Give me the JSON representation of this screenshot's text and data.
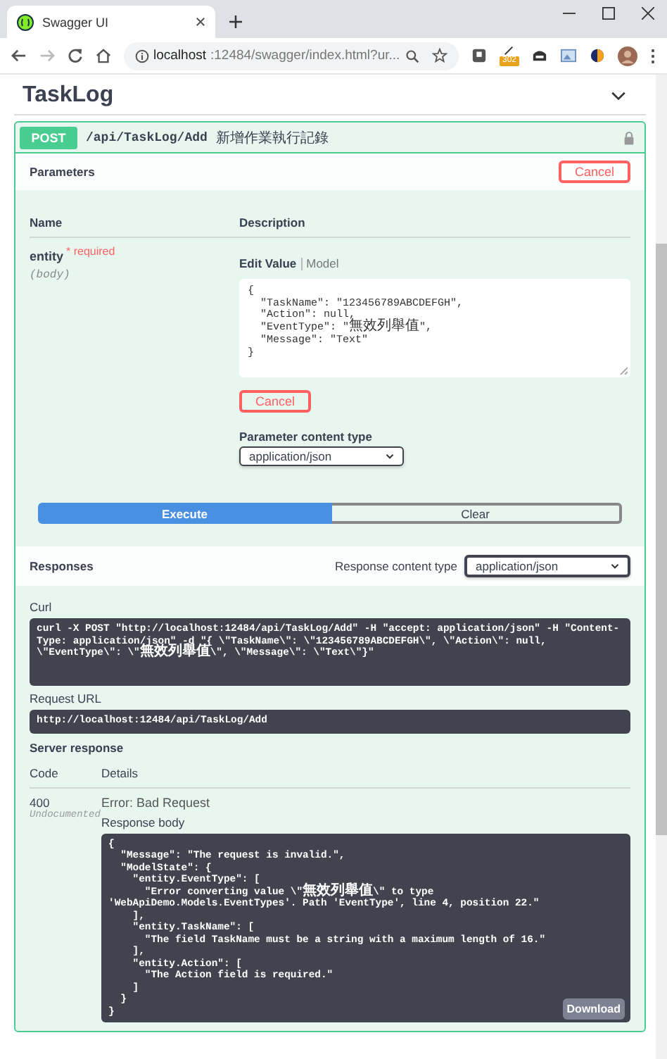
{
  "browser": {
    "tab_title": "Swagger UI",
    "url_host": "localhost",
    "url_rest": ":12484/swagger/index.html?ur...",
    "extension_badge": "302"
  },
  "section": {
    "title": "TaskLog",
    "expanded": true
  },
  "operation": {
    "method": "POST",
    "path": "/api/TaskLog/Add",
    "summary": "新增作業執行記錄",
    "locked": true,
    "parameters_title": "Parameters",
    "cancel_label": "Cancel",
    "param_columns": [
      "Name",
      "Description"
    ],
    "param": {
      "name": "entity",
      "required_label": "* required",
      "location": "(body)",
      "tabs": [
        {
          "label": "Edit Value",
          "selected": true
        },
        {
          "label": "Model",
          "selected": false
        }
      ],
      "value": "{\n  \"TaskName\": \"123456789ABCDEFGH\",\n  \"Action\": null,\n  \"EventType\": \"無效列舉值\",\n  \"Message\": \"Text\"\n}",
      "cancel_label": "Cancel",
      "content_type_label": "Parameter content type",
      "content_type": "application/json"
    },
    "execute_label": "Execute",
    "clear_label": "Clear",
    "responses": {
      "title": "Responses",
      "content_type_label": "Response content type",
      "content_type": "application/json",
      "curl_label": "Curl",
      "curl": "curl -X POST \"http://localhost:12484/api/TaskLog/Add\" -H \"accept: application/json\" -H \"Content-Type: application/json\" -d \"{ \\\"TaskName\\\": \\\"123456789ABCDEFGH\\\", \\\"Action\\\": null, \\\"EventType\\\": \\\"無效列舉值\\\", \\\"Message\\\": \\\"Text\\\"}\"",
      "request_url_label": "Request URL",
      "request_url": "http://localhost:12484/api/TaskLog/Add",
      "server_response_label": "Server response",
      "columns": [
        "Code",
        "Details"
      ],
      "code": "400",
      "code_note": "Undocumented",
      "status": "Error: Bad Request",
      "body_label": "Response body",
      "body": "{\n  \"Message\": \"The request is invalid.\",\n  \"ModelState\": {\n    \"entity.EventType\": [\n      \"Error converting value \\\"無效列舉值\\\" to type 'WebApiDemo.Models.EventTypes'. Path 'EventType', line 4, position 22.\"\n    ],\n    \"entity.TaskName\": [\n      \"The field TaskName must be a string with a maximum length of 16.\"\n    ],\n    \"entity.Action\": [\n      \"The Action field is required.\"\n    ]\n  }\n}",
      "download_label": "Download"
    }
  }
}
